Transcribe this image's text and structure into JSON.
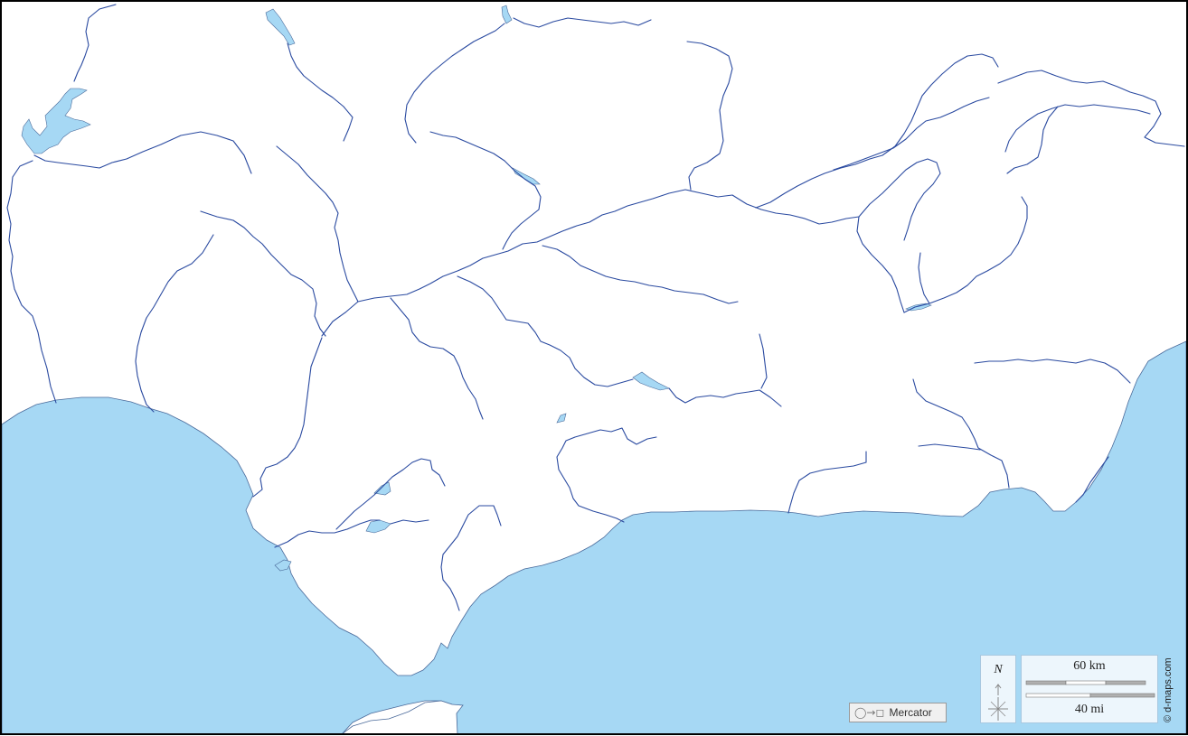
{
  "map": {
    "projection_label": "Mercator",
    "projection_symbols": "◯→◻",
    "north_label": "N",
    "scale": {
      "km_label": "60 km",
      "mi_label": "40 mi"
    },
    "credit": "© d-maps.com",
    "colors": {
      "sea": "#a6d8f4",
      "land": "#ffffff",
      "river": "#2a4aa0",
      "coast": "#4a6a9a",
      "frame": "#000000"
    }
  }
}
